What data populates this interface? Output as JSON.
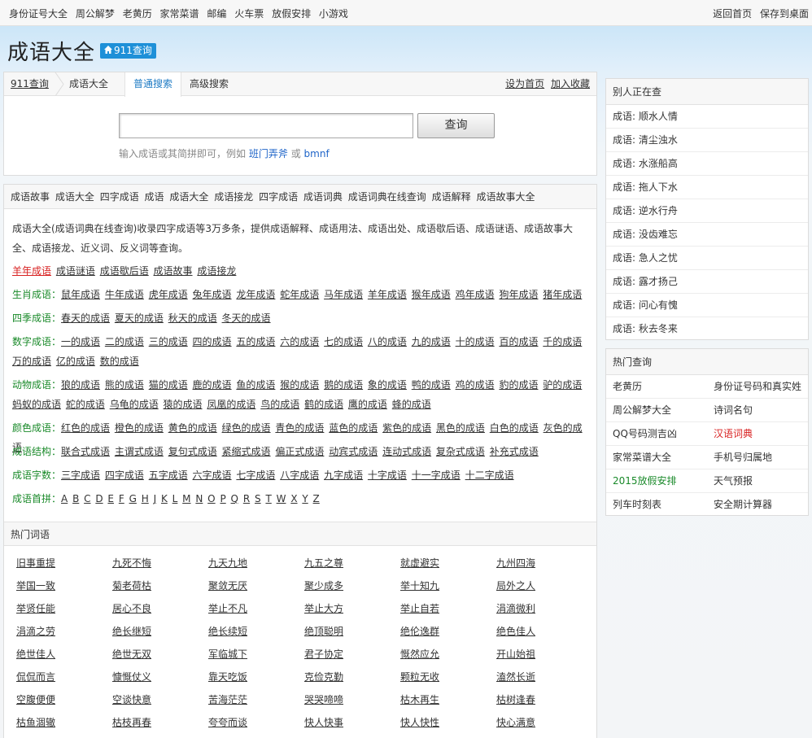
{
  "topbar": {
    "left_links": [
      "身份证号大全",
      "周公解梦",
      "老黄历",
      "家常菜谱",
      "邮编",
      "火车票",
      "放假安排",
      "小游戏"
    ],
    "right_links": [
      "返回首页",
      "保存到桌面"
    ]
  },
  "header": {
    "title": "成语大全",
    "badge": "911查询"
  },
  "search": {
    "crumbs": [
      "911查询",
      "成语大全"
    ],
    "tab_normal": "普通搜索",
    "tab_advanced": "高级搜索",
    "right_links": [
      "设为首页",
      "加入收藏"
    ],
    "input_value": "",
    "button": "查询",
    "hint_prefix": "输入成语或其简拼即可，例如",
    "hint_example1": "班门弄斧",
    "hint_or": "或",
    "hint_example2": "bmnf"
  },
  "main": {
    "head_links": [
      "成语故事",
      "成语大全",
      "四字成语",
      "成语",
      "成语大全",
      "成语接龙",
      "四字成语",
      "成语词典",
      "成语词典在线查询",
      "成语解释",
      "成语故事大全"
    ],
    "intro": "成语大全(成语词典在线查询)收录四字成语等3万多条，提供成语解释、成语用法、成语出处、成语歇后语、成语谜语、成语故事大全、成语接龙、近义词、反义词等查询。",
    "row_quick": [
      "羊年成语",
      "成语谜语",
      "成语歇后语",
      "成语故事",
      "成语接龙"
    ],
    "rows": [
      {
        "label": "生肖成语：",
        "items": [
          "鼠年成语",
          "牛年成语",
          "虎年成语",
          "兔年成语",
          "龙年成语",
          "蛇年成语",
          "马年成语",
          "羊年成语",
          "猴年成语",
          "鸡年成语",
          "狗年成语",
          "猪年成语"
        ]
      },
      {
        "label": "四季成语：",
        "items": [
          "春天的成语",
          "夏天的成语",
          "秋天的成语",
          "冬天的成语"
        ]
      },
      {
        "label": "数字成语：",
        "items": [
          "一的成语",
          "二的成语",
          "三的成语",
          "四的成语",
          "五的成语",
          "六的成语",
          "七的成语",
          "八的成语",
          "九的成语",
          "十的成语",
          "百的成语",
          "千的成语",
          "万的成语",
          "亿的成语",
          "数的成语"
        ]
      },
      {
        "label": "动物成语：",
        "items": [
          "狼的成语",
          "熊的成语",
          "猫的成语",
          "鹿的成语",
          "鱼的成语",
          "猴的成语",
          "鹅的成语",
          "象的成语",
          "鸭的成语",
          "鸡的成语",
          "豹的成语",
          "驴的成语",
          "蚂蚁的成语",
          "蛇的成语",
          "乌龟的成语",
          "猿的成语",
          "凤凰的成语",
          "鸟的成语",
          "鹤的成语",
          "鹰的成语",
          "蜂的成语"
        ]
      },
      {
        "label": "颜色成语：",
        "items": [
          "红色的成语",
          "橙色的成语",
          "黄色的成语",
          "绿色的成语",
          "青色的成语",
          "蓝色的成语",
          "紫色的成语",
          "黑色的成语",
          "白色的成语",
          "灰色的成语"
        ]
      },
      {
        "label": "成语结构：",
        "items": [
          "联合式成语",
          "主谓式成语",
          "复句式成语",
          "紧缩式成语",
          "偏正式成语",
          "动宾式成语",
          "连动式成语",
          "复杂式成语",
          "补充式成语"
        ]
      },
      {
        "label": "成语字数：",
        "items": [
          "三字成语",
          "四字成语",
          "五字成语",
          "六字成语",
          "七字成语",
          "八字成语",
          "九字成语",
          "十字成语",
          "十一字成语",
          "十二字成语"
        ]
      },
      {
        "label": "成语首拼：",
        "items": [
          "A",
          "B",
          "C",
          "D",
          "E",
          "F",
          "G",
          "H",
          "J",
          "K",
          "L",
          "M",
          "N",
          "O",
          "P",
          "Q",
          "R",
          "S",
          "T",
          "W",
          "X",
          "Y",
          "Z"
        ]
      }
    ],
    "hot_title": "热门词语",
    "hot_words": [
      "旧事重提",
      "九死不悔",
      "九天九地",
      "九五之尊",
      "就虚避实",
      "九州四海",
      "举国一致",
      "菊老荷枯",
      "聚敛无厌",
      "聚少成多",
      "举十知九",
      "局外之人",
      "举贤任能",
      "居心不良",
      "举止不凡",
      "举止大方",
      "举止自若",
      "涓滴微利",
      "涓滴之劳",
      "绝长继短",
      "绝长续短",
      "绝顶聪明",
      "绝伦逸群",
      "绝色佳人",
      "绝世佳人",
      "绝世无双",
      "军临城下",
      "君子协定",
      "慨然应允",
      "开山始祖",
      "侃侃而言",
      "慷慨仗义",
      "靠天吃饭",
      "克俭克勤",
      "颗粒无收",
      "溘然长逝",
      "空腹便便",
      "空谈快意",
      "苦海茫茫",
      "哭哭啼啼",
      "枯木再生",
      "枯树逢春",
      "枯鱼涸辙",
      "枯枝再春",
      "夸夸而谈",
      "快人快事",
      "快人快性",
      "快心满意"
    ]
  },
  "side": {
    "recent_title": "别人正在查",
    "recent": [
      "成语: 顺水人情",
      "成语: 清尘浊水",
      "成语: 水涨船高",
      "成语: 拖人下水",
      "成语: 逆水行舟",
      "成语: 没齿难忘",
      "成语: 急人之忧",
      "成语: 露才扬己",
      "成语: 问心有愧",
      "成语: 秋去冬来"
    ],
    "hot_title": "热门查询",
    "hot": [
      [
        "老黄历",
        "身份证号码和真实姓"
      ],
      [
        "周公解梦大全",
        "诗词名句"
      ],
      [
        "QQ号码测吉凶",
        "汉语词典"
      ],
      [
        "家常菜谱大全",
        "手机号归属地"
      ],
      [
        "2015放假安排",
        "天气预报"
      ],
      [
        "列车时刻表",
        "安全期计算器"
      ]
    ]
  },
  "colors": {
    "accent": "#1e90d8",
    "green": "#1a8a2a",
    "red": "#d82020"
  }
}
